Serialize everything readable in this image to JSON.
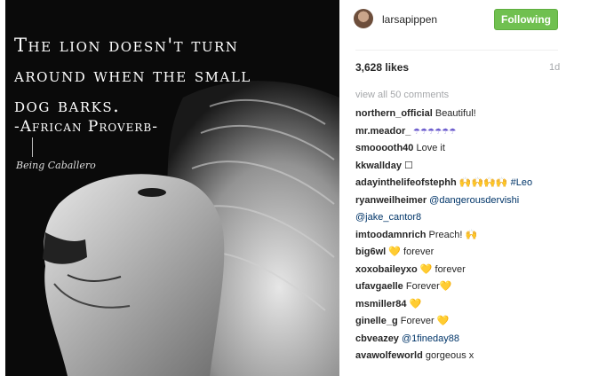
{
  "post": {
    "image": {
      "quote_lines": [
        "The lion doesn't turn",
        "around when the small",
        "dog barks."
      ],
      "attribution": "-African Proverb-",
      "watermark": "Being Caballero"
    },
    "author": {
      "username": "larsapippen",
      "follow_label": "Following"
    },
    "likes": "3,628 likes",
    "time_ago": "1d",
    "view_all": "view all 50 comments",
    "comments": [
      {
        "user": "northern_official",
        "text": " Beautiful!",
        "link": ""
      },
      {
        "user": "mr.meador_",
        "text": " ☂☂☂☂☂☂",
        "link": ""
      },
      {
        "user": "smooooth40",
        "text": " Love it",
        "link": ""
      },
      {
        "user": "kkwallday",
        "text": " ☐",
        "link": ""
      },
      {
        "user": "adayinthelifeofstephh",
        "text": " 🙌🙌🙌🙌 ",
        "link": "#Leo"
      },
      {
        "user": "ryanweilheimer",
        "text": " ",
        "link": "@dangerousdervishi"
      },
      {
        "user": "",
        "text": "",
        "link": "@jake_cantor8"
      },
      {
        "user": "imtoodamnrich",
        "text": " Preach! 🙌",
        "link": ""
      },
      {
        "user": "big6wl",
        "text": " 💛 forever",
        "link": ""
      },
      {
        "user": "xoxobaileyxo",
        "text": " 💛 forever",
        "link": ""
      },
      {
        "user": "ufavgaelle",
        "text": " Forever💛",
        "link": ""
      },
      {
        "user": "msmiller84",
        "text": " 💛",
        "link": ""
      },
      {
        "user": "ginelle_g",
        "text": " Forever 💛",
        "link": ""
      },
      {
        "user": "cbveazey",
        "text": " ",
        "link": "@1fineday88"
      },
      {
        "user": "avawolfeworld",
        "text": " gorgeous x",
        "link": ""
      }
    ]
  },
  "colors": {
    "follow_green": "#70c050",
    "link_blue": "#003569",
    "muted": "#a5a7aa"
  }
}
